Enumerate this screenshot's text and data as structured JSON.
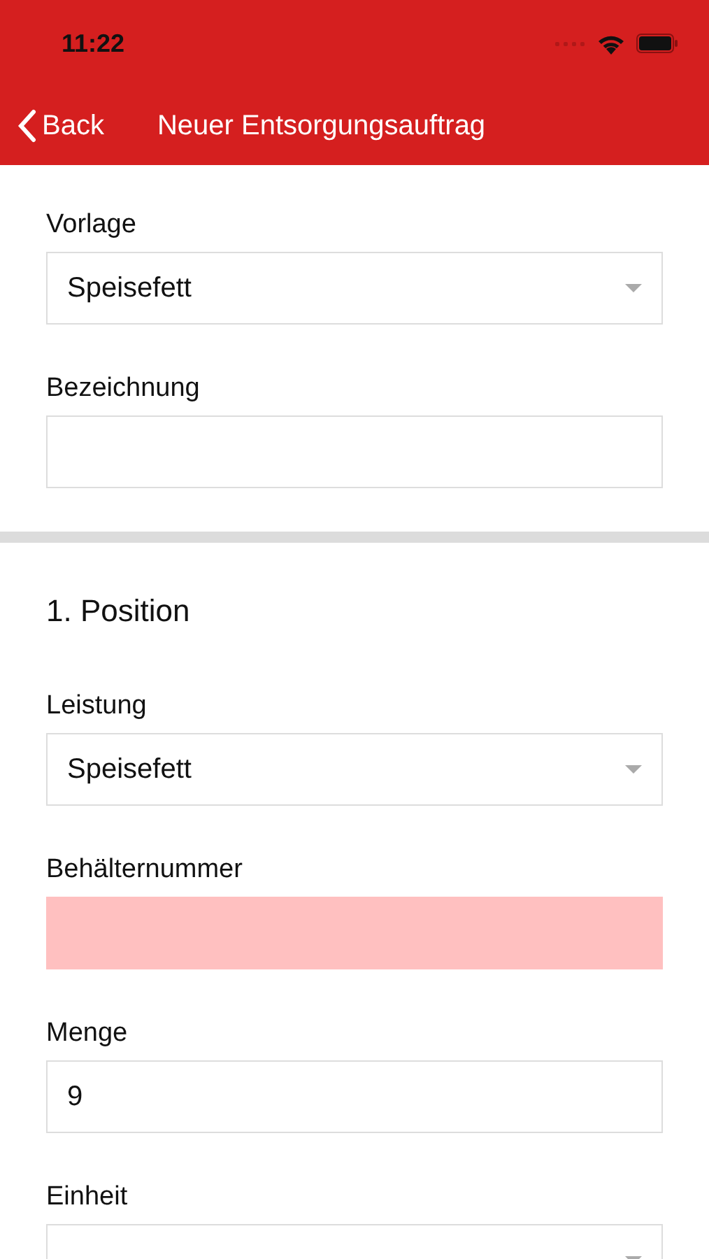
{
  "status_bar": {
    "time": "11:22"
  },
  "nav": {
    "back": "Back",
    "title": "Neuer Entsorgungsauftrag"
  },
  "sections": [
    {
      "fields": [
        {
          "label": "Vorlage",
          "kind": "select",
          "value": "Speisefett",
          "invalid": false
        },
        {
          "label": "Bezeichnung",
          "kind": "text",
          "invalid": false
        }
      ]
    },
    {
      "heading": "1. Position",
      "fields": [
        {
          "label": "Leistung",
          "kind": "select",
          "value": "Speisefett",
          "invalid": false
        },
        {
          "label": "Behälternummer",
          "kind": "text",
          "invalid": true
        },
        {
          "label": "Menge",
          "kind": "text",
          "value": "9",
          "invalid": false
        },
        {
          "label": "Einheit",
          "kind": "select",
          "invalid": false
        }
      ]
    }
  ]
}
